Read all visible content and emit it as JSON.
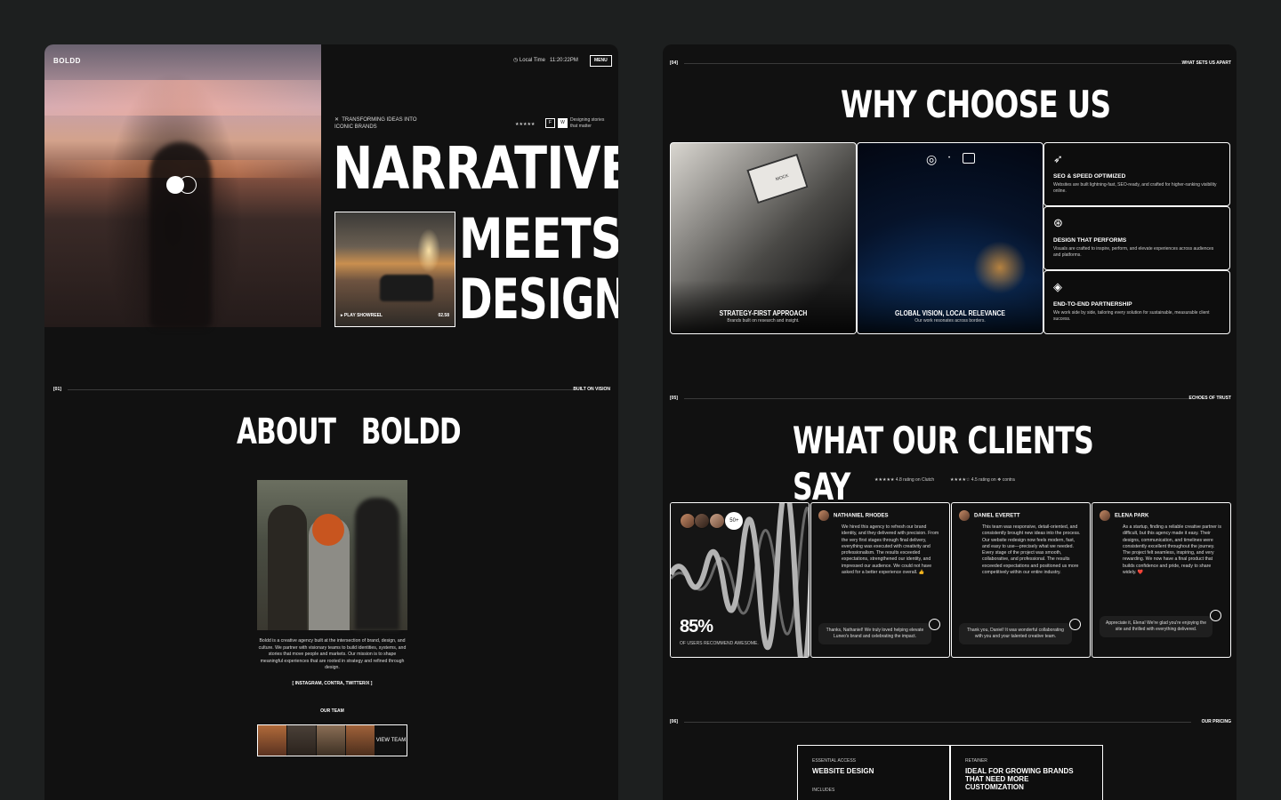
{
  "left": {
    "brand": "BOLDD",
    "local_time_label": "Local Time",
    "local_time": "11:20:22PM",
    "menu_label": "MENU",
    "tagline_x": "✕",
    "tagline": "TRANSFORMING IDEAS INTO ICONIC BRANDS",
    "rating_stars": "★★★★★",
    "badge_1": "F",
    "badge_2": "W",
    "side_note": "Designing stories that matter",
    "hero_line_1": "NARRATIVE",
    "hero_line_2": "MEETS",
    "hero_line_3": "DESIGN",
    "showreel_label": "▸ PLAY SHOWREEL",
    "showreel_time": "02.58",
    "section_num": "[01]",
    "section_tag": "BUILT ON VISION",
    "about_title": "ABOUT   BOLDD",
    "about_text": "Boldd is a creative agency built at the intersection of brand, design, and culture. We partner with visionary teams to build identities, systems, and stories that move people and markets. Our mission is to shape meaningful experiences that are rooted in strategy and refined through design.",
    "social_links": "[ INSTAGRAM,  CONTRA,  TWITTER/X ]",
    "our_team_label": "OUR TEAM",
    "view_team_label": "VIEW TEAM"
  },
  "right": {
    "s4_num": "[04]",
    "s4_tag": "WHAT SETS US APART",
    "why_title": "WHY CHOOSE US",
    "card_strategy_title": "STRATEGY-FIRST APPROACH",
    "card_strategy_text": "Brands built on research and insight.",
    "card_global_title": "GLOBAL VISION, LOCAL RELEVANCE",
    "card_global_text": "Our work resonates across borders.",
    "mock_label": "MOCK",
    "features": [
      {
        "icon": "rocket-icon",
        "title": "SEO & SPEED OPTIMIZED",
        "text": "Websites are built lightning-fast, SEO-ready, and crafted for higher-ranking visibility online."
      },
      {
        "icon": "overlap-circles-icon",
        "title": "DESIGN THAT PERFORMS",
        "text": "Visuals are crafted to inspire, perform, and elevate experiences across audiences and platforms."
      },
      {
        "icon": "layers-icon",
        "title": "END-TO-END PARTNERSHIP",
        "text": "We work side by side, tailoring every solution for sustainable, measurable client success."
      }
    ],
    "s5_num": "[05]",
    "s5_tag": "ECHOES OF TRUST",
    "clients_title": "WHAT OUR CLIENTS SAY",
    "rating_clutch": "★★★★★ 4.8 rating on Clutch",
    "rating_contra": "★★★★☆ 4.5 rating on ❖ contra",
    "avatars_count": "50+",
    "stat_value": "85%",
    "stat_label": "OF USERS RECOMMEND AWESOME.",
    "reviews": [
      {
        "name": "NATHANIEL RHODES",
        "text": "We hired this agency to refresh our brand identity, and they delivered with precision. From the very first stages through final delivery, everything was executed with creativity and professionalism. The results exceeded expectations, strengthened our identity, and impressed our audience. We could not have asked for a better experience overall. 👍",
        "reply": "Thanks, Nathaniel! We truly loved helping elevate Luneo's brand and celebrating the impact."
      },
      {
        "name": "DANIEL EVERETT",
        "text": "This team was responsive, detail-oriented, and consistently brought new ideas into the process. Our website redesign now feels modern, fast, and easy to use—precisely what we needed. Every stage of the project was smooth, collaborative, and professional. The results exceeded expectations and positioned us more competitively within our entire industry.",
        "reply": "Thank you, Daniel! It was wonderful collaborating with you and your talented creative team."
      },
      {
        "name": "ELENA PARK",
        "text": "As a startup, finding a reliable creative partner is difficult, but this agency made it easy. Their designs, communication, and timelines were consistently excellent throughout the journey. The project felt seamless, inspiring, and very rewarding. We now have a final product that builds confidence and pride, ready to share widely. ❤️",
        "reply": "Appreciate it, Elena! We're glad you're enjoying the site and thrilled with everything delivered."
      }
    ],
    "s6_num": "[06]",
    "s6_tag": "OUR PRICING",
    "plan1_tier": "ESSENTIAL ACCESS",
    "plan1_name": "WEBSITE DESIGN",
    "plan1_includes": "INCLUDES",
    "plan2_tier": "RETAINER",
    "plan2_name": "IDEAL FOR GROWING BRANDS THAT NEED MORE CUSTOMIZATION"
  }
}
